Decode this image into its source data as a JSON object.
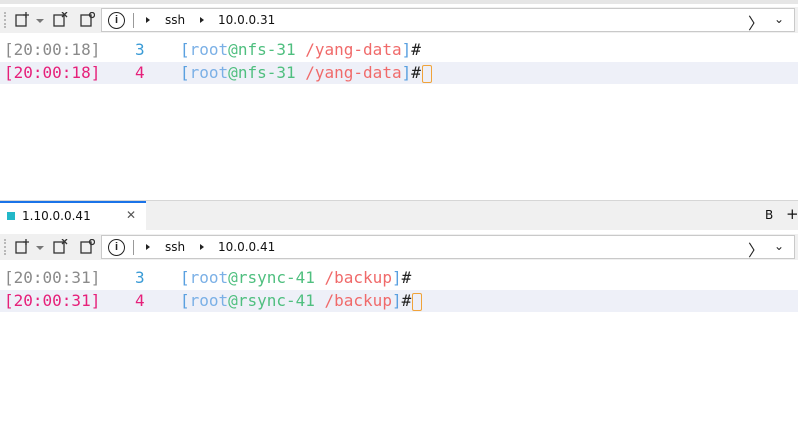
{
  "pane1": {
    "address": {
      "protocol": "ssh",
      "host": "10.0.0.31"
    },
    "lines": [
      {
        "time": "[20:00:18]",
        "num": "3",
        "user": "root",
        "at": "@",
        "host": "nfs-31",
        "path": "/yang-data",
        "hash": "#"
      },
      {
        "time": "[20:00:18]",
        "num": "4",
        "user": "root",
        "at": "@",
        "host": "nfs-31",
        "path": "/yang-data",
        "hash": "#"
      }
    ]
  },
  "tab": {
    "label": "1.10.0.0.41",
    "close": "✕",
    "right_b": "B",
    "right_plus": "+"
  },
  "pane2": {
    "address": {
      "protocol": "ssh",
      "host": "10.0.0.41"
    },
    "lines": [
      {
        "time": "[20:00:31]",
        "num": "3",
        "user": "root",
        "at": "@",
        "host": "rsync-41",
        "path": "/backup",
        "hash": "#"
      },
      {
        "time": "[20:00:31]",
        "num": "4",
        "user": "root",
        "at": "@",
        "host": "rsync-41",
        "path": "/backup",
        "hash": "#"
      }
    ]
  },
  "colors": {
    "time_normal": "#8a8a8a",
    "time_active": "#e6207a",
    "num": "#3a9bd6",
    "num_active": "#e6207a",
    "bracket": "#5aa0e0",
    "user": "#7bb0e6",
    "host": "#4fbf7f",
    "path": "#f06a6a",
    "hash": "#222222",
    "cursor": "#f0a33a"
  },
  "icons": [
    "new-session-icon",
    "dropdown-caret-icon",
    "close-session-icon",
    "open-folder-icon",
    "info-icon",
    "go-arrow-icon",
    "chevron-down-icon"
  ]
}
